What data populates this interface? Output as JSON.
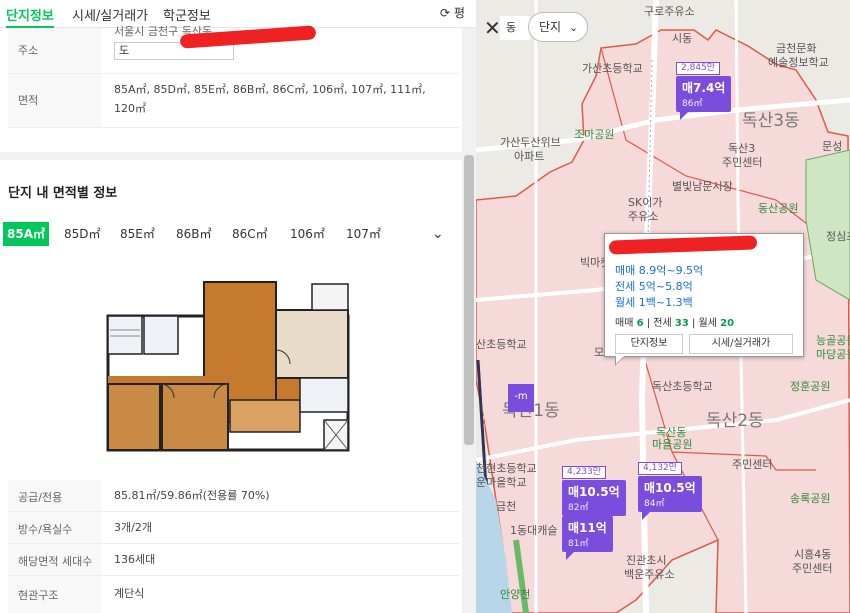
{
  "tabs": [
    {
      "label": "단지정보"
    },
    {
      "label": "시세/실거래가"
    },
    {
      "label": "학군정보"
    }
  ],
  "refresh_label": "⟳ 평",
  "info": {
    "address_label": "주소",
    "address_value": "서울시 금천구 독산동",
    "address_sub": "도",
    "area_label": "면적",
    "area_value_line1": "85A㎡, 85D㎡, 85E㎡, 86B㎡, 86C㎡, 106㎡, 107㎡, 111㎡,",
    "area_value_line2": "120㎡"
  },
  "section_title": "단지 내 면적별 정보",
  "area_tabs": [
    "85A㎡",
    "85D㎡",
    "85E㎡",
    "86B㎡",
    "86C㎡",
    "106㎡",
    "107㎡"
  ],
  "details": [
    {
      "label": "공급/전용",
      "value": "85.81㎡/59.86㎡(전용률 70%)"
    },
    {
      "label": "방수/욕실수",
      "value": "3개/2개"
    },
    {
      "label": "해당면적 세대수",
      "value": "136세대"
    },
    {
      "label": "현관구조",
      "value": "계단식"
    }
  ],
  "map": {
    "pill_partial": "동",
    "danji_pill": "단지",
    "labels": {
      "gurojuyuso": "구로주유소",
      "sido": "시동",
      "gasanjung": "가산초등학교",
      "geumcheon": "금천문화",
      "yesul": "예술정보학교",
      "gasandusan": "가산두산위브",
      "apt": "아파트",
      "jomapark": "조마공원",
      "dongsan3": "독산3동",
      "dongsan3_center": "독산3",
      "dongsan3_center2": "주민센터",
      "byeolbit": "별빛남문시장",
      "sk": "SK이가",
      "sk2": "주유소",
      "dongsan_park": "동산공원",
      "munseong": "문성",
      "jeongsim": "정심초",
      "bitmaeul": "빅마켓",
      "sanchodong": "산초등학교",
      "dongsan1": "독산1동",
      "dongsanchodong": "독산초등학교",
      "dongsan2": "독산2동",
      "dongsan_maeul": "독산동",
      "dongsan_maeul2": "마을공원",
      "jumincenter": "주민센터",
      "neunggok": "능골공원",
      "madang": "마당공원",
      "jeonggok": "정훈공원",
      "cheonhyeon": "천현초등학교",
      "unmaeul": "운마을학교",
      "songrok": "송록공원",
      "siheung4": "시흥4동",
      "siheung4_2": "주민센터",
      "jingwan": "진관초시",
      "baekmun": "백운주유소",
      "anyang": "안양천",
      "daegumun": "1동대캐슬",
      "icon_geum": "금천",
      "gasan_road": "공원",
      "dong_partial": "동",
      "mo": "모"
    },
    "markers": [
      {
        "top": "2,845만",
        "price": "매7.4억",
        "area": "86㎡"
      },
      {
        "top": "4,233만",
        "price": "매10.5억",
        "area": "82㎡"
      },
      {
        "top": "4,132만",
        "price": "매10.5억",
        "area": "84㎡"
      },
      {
        "top": "",
        "price": "매11억",
        "area": "81㎡"
      }
    ],
    "dot_marker": "-m",
    "popup": {
      "sale": "매매 8.9억~9.5억",
      "jeonse": "전세 5억~5.8억",
      "wolse": "월세 1백~1.3백",
      "counts": {
        "sale_label": "매매",
        "sale_n": "6",
        "jeonse_label": "전세",
        "jeonse_n": "33",
        "wolse_label": "월세",
        "wolse_n": "20"
      },
      "btn_info": "단지정보",
      "btn_price": "시세/실거래가"
    }
  },
  "colors": {
    "accent": "#03c75a",
    "marker": "#7b4ddd",
    "boundary": "#e05a48",
    "redact": "#ee2222"
  }
}
